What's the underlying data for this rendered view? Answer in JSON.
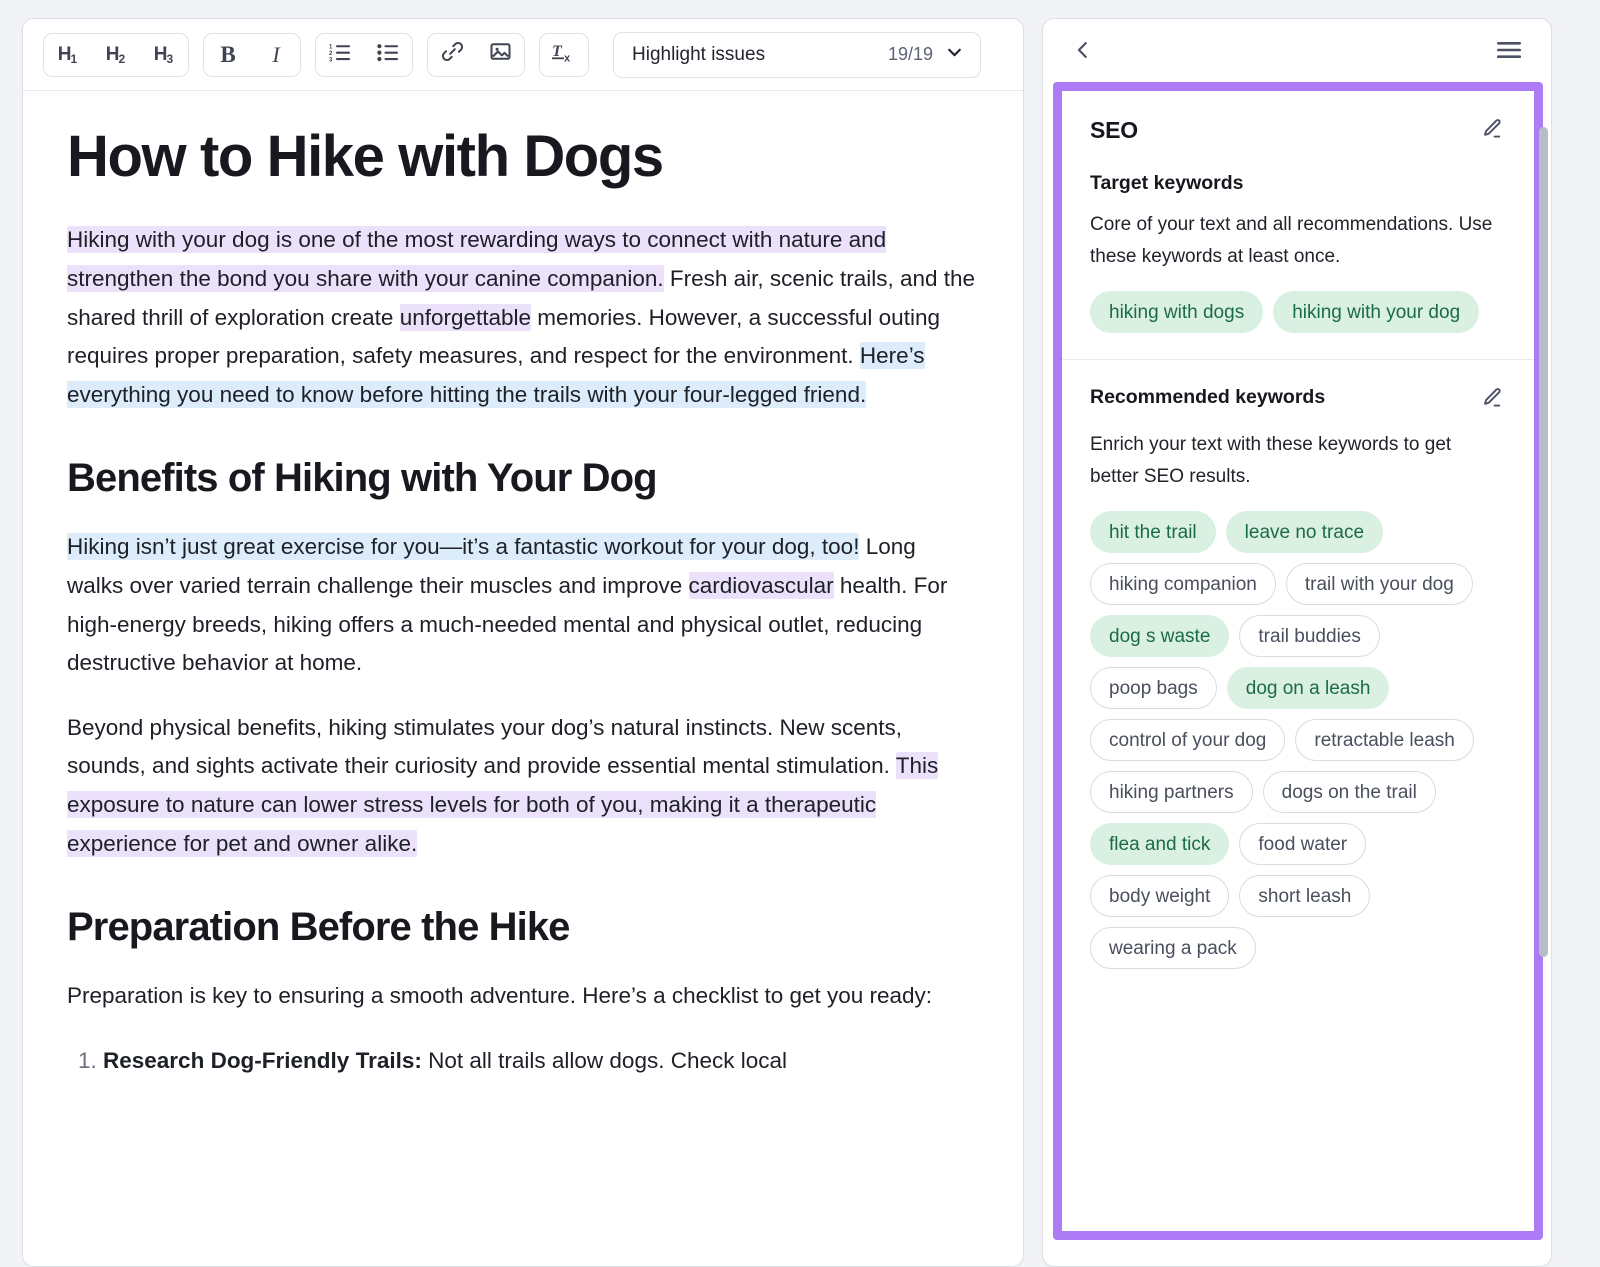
{
  "editor": {
    "toolbar": {
      "heading_buttons": [
        {
          "name": "h1",
          "label": "H",
          "sub": "1"
        },
        {
          "name": "h2",
          "label": "H",
          "sub": "2"
        },
        {
          "name": "h3",
          "label": "H",
          "sub": "3"
        }
      ],
      "format_buttons": [
        {
          "name": "bold",
          "label": "B"
        },
        {
          "name": "italic",
          "label": "I"
        }
      ],
      "list_buttons": [
        {
          "name": "ordered-list",
          "icon": "ordered-list-icon"
        },
        {
          "name": "bullet-list",
          "icon": "bullet-list-icon"
        }
      ],
      "insert_buttons": [
        {
          "name": "link",
          "icon": "link-icon"
        },
        {
          "name": "image",
          "icon": "image-icon"
        }
      ],
      "clear_button": {
        "name": "clear-formatting",
        "icon": "clear-formatting-icon"
      },
      "highlight_select": {
        "label": "Highlight issues",
        "count": "19/19",
        "chevron": "chevron-down-icon"
      }
    },
    "document": {
      "title": "How to Hike with Dogs",
      "p1": {
        "part1": "Hiking with your dog is one of the most rewarding ways to connect with nature and strengthen the bond you share with your canine companion.",
        "part2": " Fresh air, scenic trails, and the shared thrill of exploration create ",
        "part3": "unforgettable",
        "part4": " memories. However, a successful outing requires proper preparation, safety measures, and respect for the environment. ",
        "part5": "Here’s everything you need to know before hitting the trails with your four-legged friend."
      },
      "h2_benefits": "Benefits of Hiking with Your Dog",
      "p2": {
        "part1": "Hiking isn’t just great exercise for you—it’s a fantastic workout for your dog, too!",
        "part2": " Long walks over varied terrain challenge their muscles and improve ",
        "part3": "cardiovascular",
        "part4": " health. For high-energy breeds, hiking offers a much-needed mental and physical outlet, reducing destructive behavior at home."
      },
      "p3": {
        "part1": "Beyond physical benefits, hiking stimulates your dog’s natural instincts. New scents, sounds, and sights activate their curiosity and provide essential mental stimulation. ",
        "part2": "This exposure to nature can lower stress levels for both of you, making it a therapeutic experience for pet and owner alike."
      },
      "h2_preparation": "Preparation Before the Hike",
      "p4": "Preparation is key to ensuring a smooth adventure. Here’s a checklist to get you ready:",
      "list_items": [
        {
          "bold": "Research Dog-Friendly Trails:",
          "rest": " Not all trails allow dogs. Check local"
        }
      ]
    }
  },
  "seo_panel": {
    "topbar": {
      "back_icon": "chevron-left-icon",
      "menu_icon": "hamburger-menu-icon"
    },
    "title": "SEO",
    "title_edit_icon": "pencil-edit-icon",
    "target_keywords": {
      "heading": "Target keywords",
      "description": "Core of your text and all recommendations. Use these keywords at least once.",
      "chips": [
        {
          "label": "hiking with dogs",
          "state": "used"
        },
        {
          "label": "hiking with your dog",
          "state": "used"
        }
      ]
    },
    "recommended_keywords": {
      "heading": "Recommended keywords",
      "edit_icon": "pencil-edit-icon",
      "description": "Enrich your text with these keywords to get better SEO results.",
      "chips": [
        {
          "label": "hit the trail",
          "state": "used"
        },
        {
          "label": "leave no trace",
          "state": "used"
        },
        {
          "label": "hiking companion",
          "state": "unused"
        },
        {
          "label": "trail with your dog",
          "state": "unused"
        },
        {
          "label": "dog s waste",
          "state": "used"
        },
        {
          "label": "trail buddies",
          "state": "unused"
        },
        {
          "label": "poop bags",
          "state": "unused"
        },
        {
          "label": "dog on a leash",
          "state": "used"
        },
        {
          "label": "control of your dog",
          "state": "unused"
        },
        {
          "label": "retractable leash",
          "state": "unused"
        },
        {
          "label": "hiking partners",
          "state": "unused"
        },
        {
          "label": "dogs on the trail",
          "state": "unused"
        },
        {
          "label": "flea and tick",
          "state": "used"
        },
        {
          "label": "food water",
          "state": "unused"
        },
        {
          "label": "body weight",
          "state": "unused"
        },
        {
          "label": "short leash",
          "state": "unused"
        },
        {
          "label": "wearing a pack",
          "state": "unused"
        }
      ]
    }
  },
  "colors": {
    "highlight_border": "#ad7bf5",
    "chip_used_bg": "#d9f0e3",
    "chip_used_text": "#1c6b47",
    "mark_purple": "#ece1fb",
    "mark_blue": "#dcecfa"
  }
}
